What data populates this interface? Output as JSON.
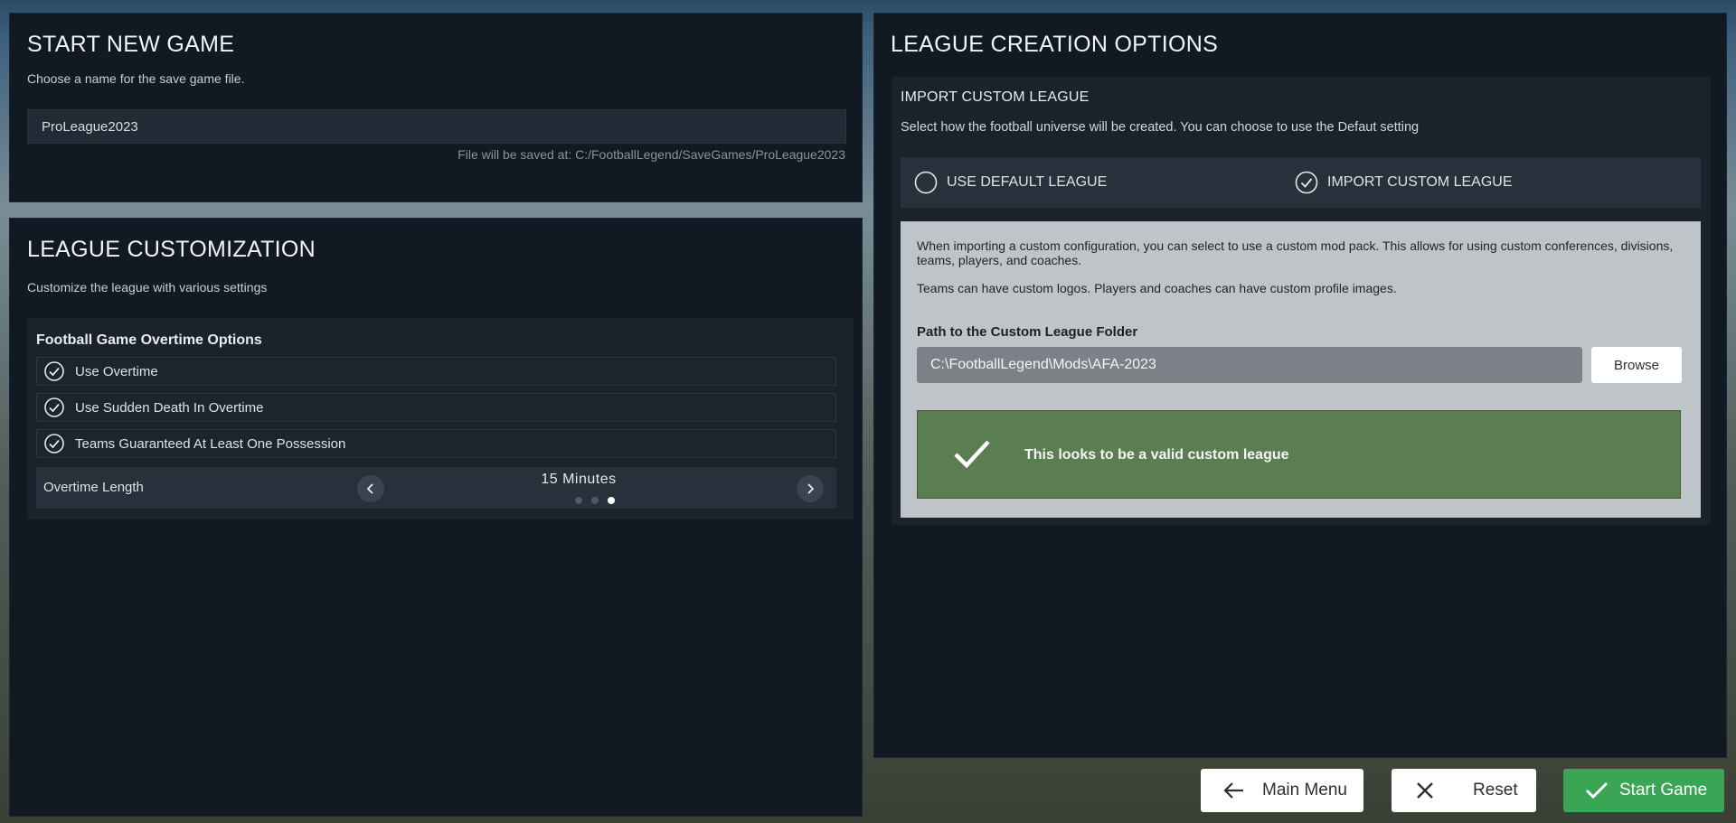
{
  "start_game": {
    "title": "START NEW GAME",
    "subtitle": "Choose a name for the save game file.",
    "save_name": "ProLeague2023",
    "save_path": "File will be saved at: C:/FootballLegend/SaveGames/ProLeague2023"
  },
  "league_customization": {
    "title": "LEAGUE CUSTOMIZATION",
    "subtitle": "Customize the league with various settings",
    "overtime": {
      "title": "Football Game Overtime Options",
      "options": [
        {
          "label": "Use Overtime",
          "checked": true
        },
        {
          "label": "Use Sudden Death In Overtime",
          "checked": true
        },
        {
          "label": "Teams Guaranteed At Least One Possession",
          "checked": true
        }
      ],
      "length_label": "Overtime Length",
      "length_value": "15 Minutes",
      "length_index": 2,
      "length_count": 3
    }
  },
  "league_options": {
    "title": "LEAGUE CREATION OPTIONS",
    "section_title": "IMPORT CUSTOM LEAGUE",
    "description": "Select how the football universe will be created. You can choose to use the Defaut setting",
    "choices": [
      {
        "label": "USE DEFAULT LEAGUE",
        "selected": false
      },
      {
        "label": "IMPORT CUSTOM LEAGUE",
        "selected": true
      }
    ],
    "info_1": "When importing a custom configuration, you can select to use a custom mod pack. This allows for using custom conferences, divisions, teams, players, and coaches.",
    "info_2": "Teams can have custom logos. Players and coaches can have custom profile images.",
    "path_label": "Path to the Custom League Folder",
    "path_value": "C:\\FootballLegend\\Mods\\AFA-2023",
    "browse_label": "Browse",
    "valid_message": "This looks to be a valid custom league"
  },
  "buttons": {
    "main_menu": "Main Menu",
    "reset": "Reset",
    "start_game": "Start Game"
  },
  "colors": {
    "panel_bg": "#111923",
    "valid_green": "#5a7d52",
    "start_green": "#3aa554"
  }
}
